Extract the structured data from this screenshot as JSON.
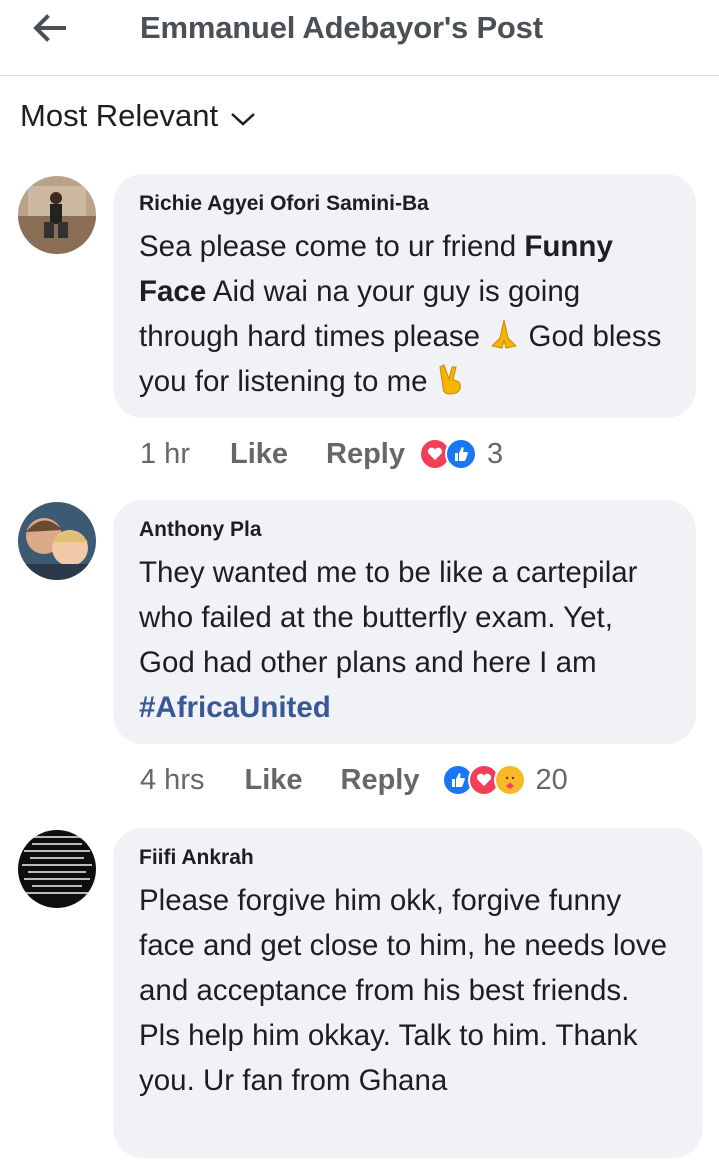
{
  "header": {
    "title": "Emmanuel Adebayor's Post",
    "back_icon": "arrow-left-icon"
  },
  "sort": {
    "label": "Most Relevant",
    "icon": "chevron-down-icon"
  },
  "comments": [
    {
      "author": "Richie Agyei Ofori Samini-Ba",
      "text_segments": [
        "Sea please come to ur friend ",
        "Funny Face",
        " Aid wai na your guy is going through hard times please ",
        " God bless you for listening to me "
      ],
      "emojis": [
        "praying-hands-icon",
        "victory-hand-icon"
      ],
      "time": "1 hr",
      "like": "Like",
      "reply": "Reply",
      "reactions": [
        "love",
        "like"
      ],
      "reaction_count": "3"
    },
    {
      "author": "Anthony Pla",
      "text_segments": [
        "They wanted me to be like a cartepilar who failed at the butterfly exam. Yet, God had other plans and here I am "
      ],
      "hashtag": "#AfricaUnited",
      "time": "4 hrs",
      "like": "Like",
      "reply": "Reply",
      "reactions": [
        "like",
        "love",
        "care"
      ],
      "reaction_count": "20"
    },
    {
      "author": "Fiifi Ankrah",
      "text_segments": [
        "Please forgive him okk, forgive funny face and get close to him, he needs love and acceptance from his best friends. Pls help him okkay. Talk to him. Thank you. Ur fan from Ghana"
      ]
    }
  ],
  "colors": {
    "bubble": "#f0f2f5",
    "like_blue": "#1877f2",
    "love_red": "#f33e58",
    "hashtag": "#385898",
    "meta_gray": "#65676b"
  }
}
